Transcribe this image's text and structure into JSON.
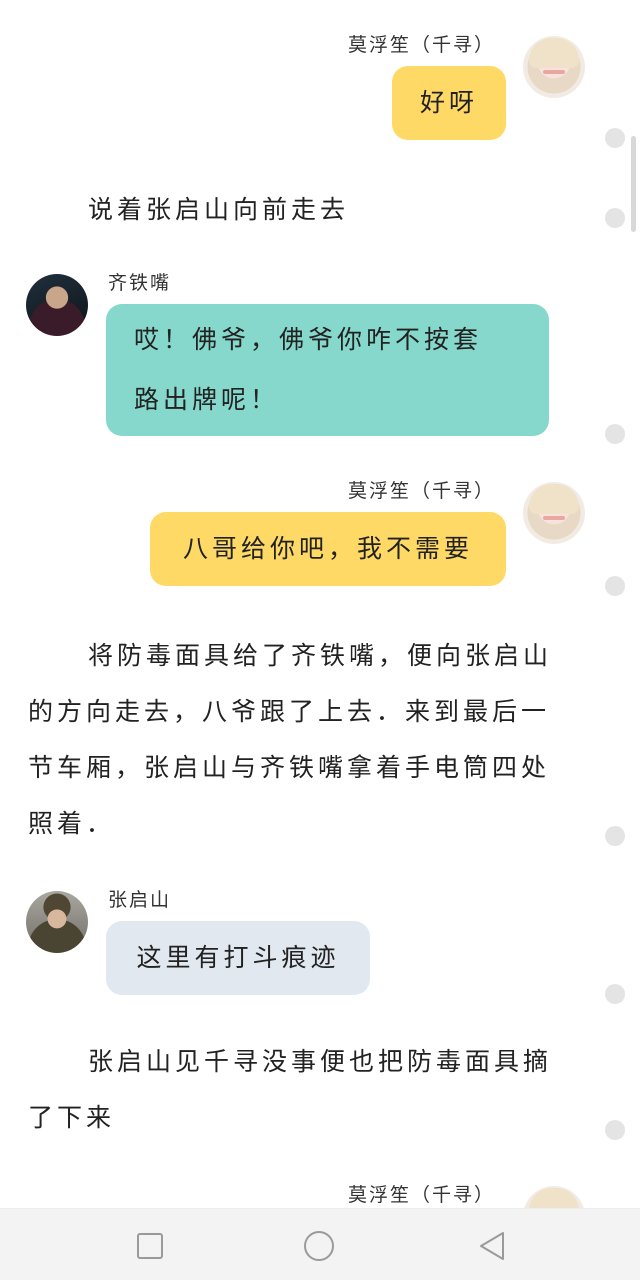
{
  "messages": [
    {
      "type": "chat",
      "side": "right",
      "speaker": "莫浮笙（千寻）",
      "text": "好呀"
    },
    {
      "type": "narration",
      "text": "说着张启山向前走去"
    },
    {
      "type": "chat",
      "side": "left",
      "speaker": "齐铁嘴",
      "lines": [
        "哎！佛爷，佛爷你咋不按套",
        "路出牌呢！"
      ]
    },
    {
      "type": "chat",
      "side": "right",
      "speaker": "莫浮笙（千寻）",
      "text": "八哥给你吧，我不需要"
    },
    {
      "type": "narration",
      "lines": [
        "将防毒面具给了齐铁嘴，便向张启山",
        "的方向走去，八爷跟了上去．来到最后一",
        "节车厢，张启山与齐铁嘴拿着手电筒四处",
        "照着．"
      ]
    },
    {
      "type": "chat",
      "side": "left",
      "speaker": "张启山",
      "text": "这里有打斗痕迹"
    },
    {
      "type": "narration",
      "lines": [
        "张启山见千寻没事便也把防毒面具摘",
        "了下来"
      ]
    },
    {
      "type": "chat",
      "side": "right",
      "speaker": "莫浮笙（千寻）",
      "text": ""
    }
  ],
  "colors": {
    "user_bubble": "#ffd966",
    "qi_bubble": "#86d8cc",
    "zhang_bubble": "#e1e8f0",
    "nav_background": "#f3f3f3"
  },
  "navbar": {
    "recent_icon": "square-icon",
    "home_icon": "circle-icon",
    "back_icon": "triangle-back-icon"
  }
}
